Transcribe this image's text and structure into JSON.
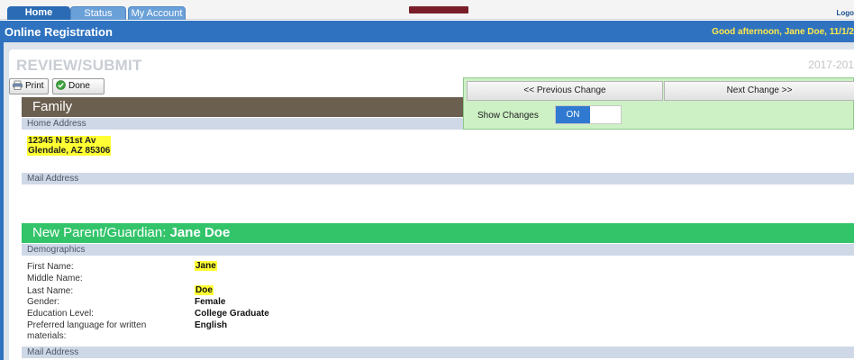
{
  "tabs": [
    {
      "label": "Home"
    },
    {
      "label": "Status"
    },
    {
      "label": "My Account"
    }
  ],
  "logout": "Logo",
  "header": {
    "title": "Online Registration",
    "greeting": "Good afternoon, Jane Doe, 11/1/2"
  },
  "page": {
    "title": "REVIEW/SUBMIT",
    "year": "2017-201"
  },
  "toolbar": {
    "print_label": "Print",
    "done_label": "Done"
  },
  "changes": {
    "previous_label": "<< Previous Change",
    "next_label": "Next Change >>",
    "show_label": "Show Changes",
    "toggle_value": "ON"
  },
  "family": {
    "title": "Family",
    "home_address_label": "Home Address",
    "address_line1": "12345 N 51st Av",
    "address_line2": "Glendale, AZ 85306",
    "mail_address_label": "Mail Address"
  },
  "guardian": {
    "title_prefix": "New Parent/Guardian:",
    "title_name": "Jane Doe",
    "demographics_label": "Demographics",
    "fields": [
      {
        "label": "First Name:",
        "value": "Jane"
      },
      {
        "label": "Middle Name:",
        "value": ""
      },
      {
        "label": "Last Name:",
        "value": "Doe"
      },
      {
        "label": "Gender:",
        "value": "Female"
      },
      {
        "label": "Education Level:",
        "value": "College Graduate"
      },
      {
        "label": "Preferred language for written",
        "value": "English"
      },
      {
        "label": "materials:",
        "value": ""
      }
    ],
    "mail_address_label": "Mail Address"
  }
}
